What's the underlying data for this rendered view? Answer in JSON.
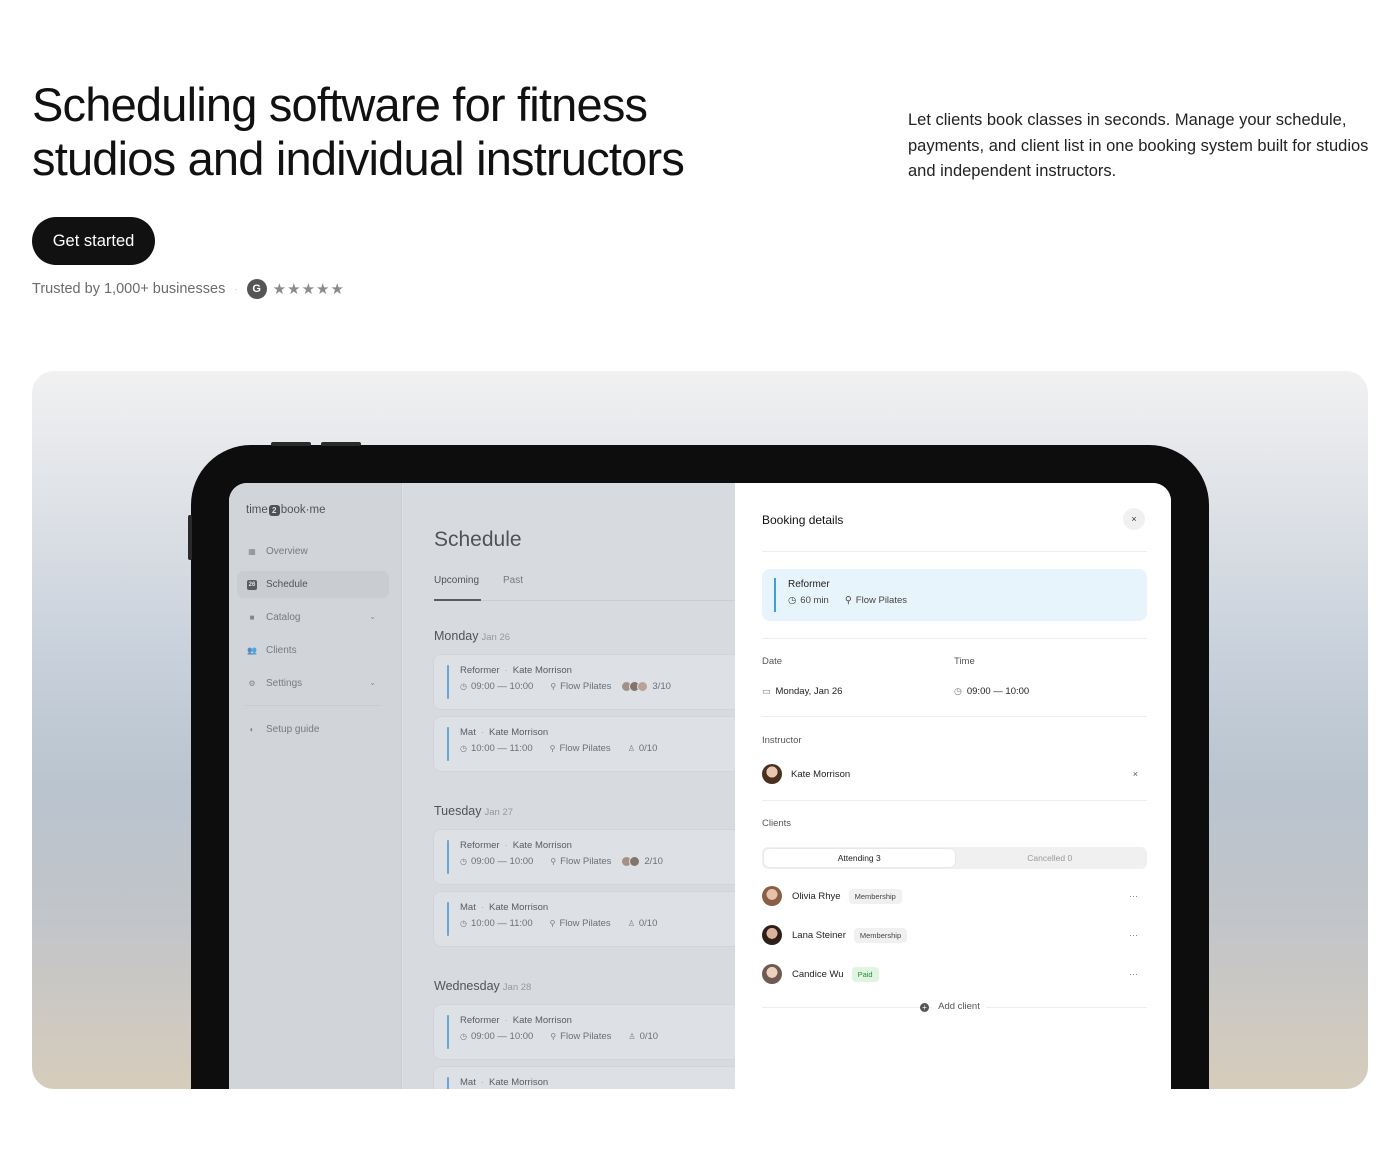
{
  "hero": {
    "title": "Scheduling software for fitness studios and individual instructors",
    "description": "Let clients book classes in seconds. Manage your schedule, payments, and client list in one booking system built for studios and independent instructors.",
    "cta_label": "Get started",
    "trust_text": "Trusted by 1,000+ businesses",
    "trust_sep": "·",
    "rating_badge": "G",
    "rating_stars": "★★★★★"
  },
  "app": {
    "logo_prefix": "time",
    "logo_mid": "2",
    "logo_suffix": "book·me",
    "nav": [
      {
        "label": "Overview",
        "icon": "▦"
      },
      {
        "label": "Schedule",
        "icon": "26"
      },
      {
        "label": "Catalog",
        "icon": "■"
      },
      {
        "label": "Clients",
        "icon": "👥"
      },
      {
        "label": "Settings",
        "icon": "⚙"
      }
    ],
    "setup_guide": "Setup guide",
    "setup_icon": "◐",
    "chevron": "⌄",
    "schedule_title": "Schedule",
    "tabs": [
      "Upcoming",
      "Past"
    ],
    "days": [
      {
        "name": "Monday",
        "date": "Jan 26"
      },
      {
        "name": "Tuesday",
        "date": "Jan 27"
      },
      {
        "name": "Wednesday",
        "date": "Jan 28"
      }
    ],
    "cards": [
      {
        "cls": "Reformer",
        "instructor": "Kate Morrison",
        "time": "09:00 — 10:00",
        "location": "Flow Pilates",
        "count": "3/10"
      },
      {
        "cls": "Mat",
        "instructor": "Kate Morrison",
        "time": "10:00 — 11:00",
        "location": "Flow Pilates",
        "count": "0/10"
      },
      {
        "cls": "Reformer",
        "instructor": "Kate Morrison",
        "time": "09:00 — 10:00",
        "location": "Flow Pilates",
        "count": "2/10"
      },
      {
        "cls": "Mat",
        "instructor": "Kate Morrison",
        "time": "10:00 — 11:00",
        "location": "Flow Pilates",
        "count": "0/10"
      },
      {
        "cls": "Reformer",
        "instructor": "Kate Morrison",
        "time": "09:00 — 10:00",
        "location": "Flow Pilates",
        "count": "0/10"
      },
      {
        "cls": "Mat",
        "instructor": "Kate Morrison"
      }
    ],
    "icons": {
      "clock": "◷",
      "pin": "⚲",
      "person": "♙"
    },
    "accent": "#3da0dd"
  },
  "booking": {
    "title": "Booking details",
    "close": "×",
    "class_name": "Reformer",
    "duration": "60 min",
    "location": "Flow Pilates",
    "date_label": "Date",
    "date_value": "Monday, Jan 26",
    "time_label": "Time",
    "time_value": "09:00 — 10:00",
    "instructor_label": "Instructor",
    "instructor_name": "Kate Morrison",
    "clients_label": "Clients",
    "seg_attending": "Attending 3",
    "seg_cancelled": "Cancelled 0",
    "clients": [
      {
        "name": "Olivia Rhye",
        "badge": "Membership"
      },
      {
        "name": "Lana Steiner",
        "badge": "Membership"
      },
      {
        "name": "Candice Wu",
        "badge": "Paid"
      }
    ],
    "more": "···",
    "add_client": "Add client",
    "add_icon": "+"
  }
}
